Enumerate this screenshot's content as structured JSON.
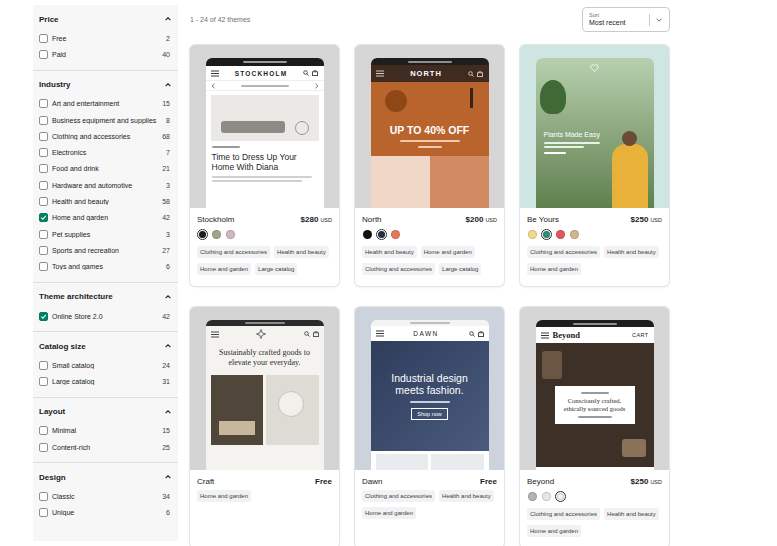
{
  "sidebar": {
    "sections": [
      {
        "title": "Price",
        "expanded": true,
        "items": [
          {
            "label": "Free",
            "count": "2",
            "checked": false
          },
          {
            "label": "Paid",
            "count": "40",
            "checked": false
          }
        ]
      },
      {
        "title": "Industry",
        "expanded": true,
        "items": [
          {
            "label": "Art and entertainment",
            "count": "15",
            "checked": false
          },
          {
            "label": "Business equipment and supplies",
            "count": "8",
            "checked": false
          },
          {
            "label": "Clothing and accessories",
            "count": "68",
            "checked": false
          },
          {
            "label": "Electronics",
            "count": "7",
            "checked": false
          },
          {
            "label": "Food and drink",
            "count": "21",
            "checked": false
          },
          {
            "label": "Hardware and automotive",
            "count": "3",
            "checked": false
          },
          {
            "label": "Health and beauty",
            "count": "58",
            "checked": false
          },
          {
            "label": "Home and garden",
            "count": "42",
            "checked": true
          },
          {
            "label": "Pet supplies",
            "count": "3",
            "checked": false
          },
          {
            "label": "Sports and recreation",
            "count": "27",
            "checked": false
          },
          {
            "label": "Toys and games",
            "count": "6",
            "checked": false
          }
        ]
      },
      {
        "title": "Theme architecture",
        "expanded": true,
        "items": [
          {
            "label": "Online Store 2.0",
            "count": "42",
            "checked": true
          }
        ]
      },
      {
        "title": "Catalog size",
        "expanded": true,
        "items": [
          {
            "label": "Small catalog",
            "count": "24",
            "checked": false
          },
          {
            "label": "Large catalog",
            "count": "31",
            "checked": false
          }
        ]
      },
      {
        "title": "Layout",
        "expanded": true,
        "items": [
          {
            "label": "Minimal",
            "count": "15",
            "checked": false
          },
          {
            "label": "Content-rich",
            "count": "25",
            "checked": false
          }
        ]
      },
      {
        "title": "Design",
        "expanded": true,
        "items": [
          {
            "label": "Classic",
            "count": "34",
            "checked": false
          },
          {
            "label": "Unique",
            "count": "6",
            "checked": false
          }
        ]
      }
    ]
  },
  "results": {
    "summary": "1 - 24 of 42 themes"
  },
  "sort": {
    "label": "Sort",
    "value": "Most recent"
  },
  "themes": [
    {
      "name": "Stockholm",
      "price": "$280",
      "currency": "USD",
      "swatches": [
        {
          "color": "#1e1e1e",
          "selected": true
        },
        {
          "color": "#9fa58f",
          "selected": false
        },
        {
          "color": "#cdb9bf",
          "selected": false
        }
      ],
      "tags": [
        "Clothing and accessories",
        "Health and beauty",
        "Home and garden",
        "Large catalog"
      ],
      "preview": {
        "logo": "STOCKHOLM",
        "headline": "Time to Dress Up Your Home With Diana"
      }
    },
    {
      "name": "North",
      "price": "$200",
      "currency": "USD",
      "swatches": [
        {
          "color": "#111111",
          "selected": false
        },
        {
          "color": "#243047",
          "selected": true
        },
        {
          "color": "#e8785a",
          "selected": false
        }
      ],
      "tags": [
        "Health and beauty",
        "Home and garden",
        "Clothing and accessories",
        "Large catalog"
      ],
      "preview": {
        "logo": "NORTH",
        "headline": "UP TO 40% OFF"
      }
    },
    {
      "name": "Be Yours",
      "price": "$250",
      "currency": "USD",
      "swatches": [
        {
          "color": "#f2d98a",
          "selected": false
        },
        {
          "color": "#2e8c7a",
          "selected": true
        },
        {
          "color": "#e0585a",
          "selected": false
        },
        {
          "color": "#d4b48a",
          "selected": false
        }
      ],
      "tags": [
        "Clothing and accessories",
        "Health and beauty",
        "Home and garden"
      ],
      "preview": {
        "headline": "Plants Made Easy"
      }
    },
    {
      "name": "Craft",
      "price": "Free",
      "swatches": [],
      "tags": [
        "Home and garden"
      ],
      "preview": {
        "headline": "Sustainably crafted goods to elevate your everyday."
      }
    },
    {
      "name": "Dawn",
      "price": "Free",
      "swatches": [],
      "tags": [
        "Clothing and accessories",
        "Health and beauty",
        "Home and garden"
      ],
      "preview": {
        "logo": "DAWN",
        "headline": "Industrial design meets fashion.",
        "button": "Shop now"
      }
    },
    {
      "name": "Beyond",
      "price": "$250",
      "currency": "USD",
      "swatches": [
        {
          "color": "#b3b3b3",
          "selected": false
        },
        {
          "color": "#e6e6e6",
          "selected": false
        },
        {
          "color": "#f2f2f2",
          "selected": true
        }
      ],
      "tags": [
        "Clothing and accessories",
        "Health and beauty",
        "Home and garden"
      ],
      "preview": {
        "logo": "Beyond",
        "cart": "CART",
        "headline": "Consciously crafted, ethically sourced goods"
      }
    }
  ]
}
